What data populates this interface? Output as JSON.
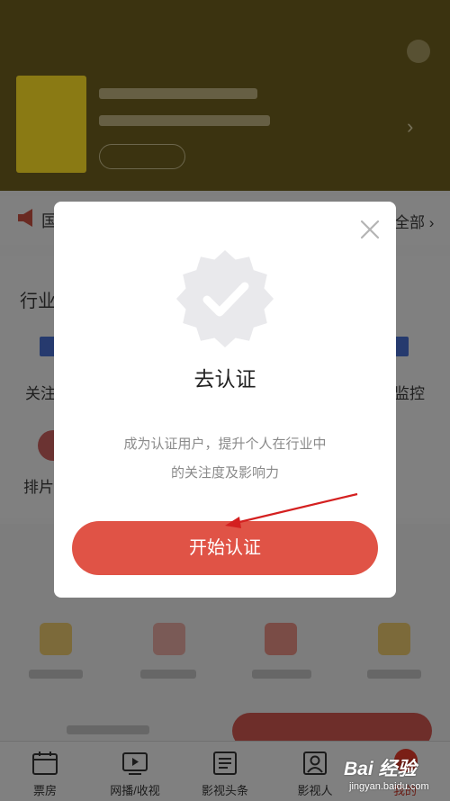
{
  "background": {
    "notice": {
      "text": "国",
      "all_label": "全部 ›"
    },
    "section_title": "行业",
    "row1": {
      "left_label": "关注",
      "right_label": "监控"
    },
    "row2": {
      "left_label": "排片"
    }
  },
  "modal": {
    "title": "去认证",
    "description_line1": "成为认证用户，提升个人在行业中",
    "description_line2": "的关注度及影响力",
    "cta_label": "开始认证",
    "close_icon": "close-icon",
    "badge_icon": "verified-check-icon"
  },
  "tabbar": {
    "items": [
      {
        "label": "票房",
        "icon": "calendar-icon"
      },
      {
        "label": "网播/收视",
        "icon": "play-icon"
      },
      {
        "label": "影视头条",
        "icon": "list-icon"
      },
      {
        "label": "影视人",
        "icon": "person-icon"
      },
      {
        "label": "我的",
        "icon": "profile-icon"
      }
    ]
  },
  "watermark": {
    "brand": "Bai 经验",
    "url": "jingyan.baidu.com"
  },
  "colors": {
    "accent": "#e05346",
    "overlay": "#7f7f7f",
    "annotation_arrow": "#d42020"
  }
}
